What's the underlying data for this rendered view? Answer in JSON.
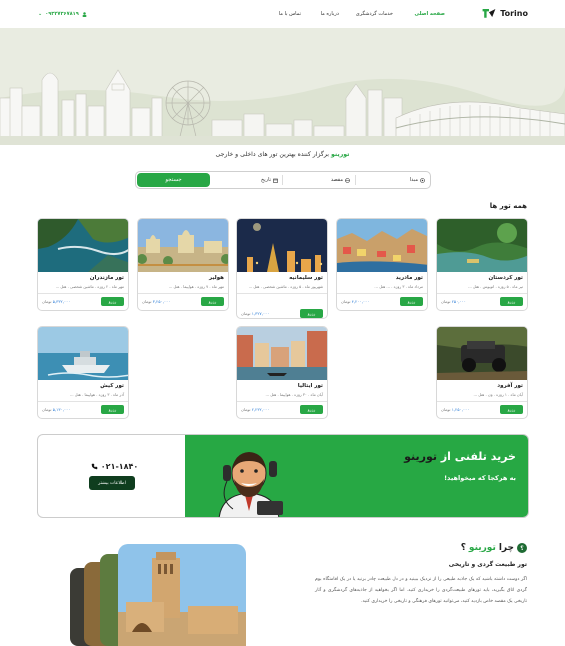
{
  "header": {
    "logo_text": "Torino",
    "nav": [
      "صفحه اصلی",
      "خدمات گردشگری",
      "درباره ما",
      "تماس با ما"
    ],
    "phone": "۰۹۳۲۷۳۶۷۸۱۹"
  },
  "hero": {
    "tagline_brand": "تورینو",
    "tagline_rest": " برگزار کننده بهترین تور های داخلی و خارجی"
  },
  "search": {
    "origin": "مبدا",
    "destination": "مقصد",
    "date": "تاریخ",
    "button": "جستجو"
  },
  "tours_title": "همه تور ها",
  "tours": [
    {
      "title": "تور کردستان",
      "details": "تیر ماه . ۵ روزه . اتوبوس . هتل ...",
      "price": "۲۵۰,۰۰۰",
      "currency": "تومان",
      "button": "رزرو"
    },
    {
      "title": "تور مادرید",
      "details": "مرداد ماه . ۳ روزه . ... هتل ...",
      "price": "۴,۲۰۰,۰۰۰",
      "currency": "تومان",
      "button": "رزرو"
    },
    {
      "title": "تور سلیمانیه",
      "details": "شهریور ماه . ۵ روزه . ماشین شخصی . هتل ...",
      "price": "۱,۳۲۷,۰۰۰",
      "currency": "تومان",
      "button": "رزرو"
    },
    {
      "title": "هولیر",
      "details": "مهر ماه . ۷ روزه . هواپیما . هتل ...",
      "price": "۳,۲۵۰,۰۰۰",
      "currency": "تومان",
      "button": "رزرو"
    },
    {
      "title": "تور مازندران",
      "details": "مهر ماه . ۲ روزه . ماشین شخصی . هتل ...",
      "price": "۵,۳۳۲,۰۰۰",
      "currency": "تومان",
      "button": "رزرو"
    },
    {
      "title": "تور آفرود",
      "details": "آبان ماه . ۱ روزه . ون . هتل ...",
      "price": "۱,۲۵۰,۰۰۰",
      "currency": "تومان",
      "button": "رزرو"
    },
    {
      "title": "تور ایتالیا",
      "details": "آبان ماه . ۳۰ روزه . هواپیما . هتل ...",
      "price": "۲,۲۳۲,۰۰۰",
      "currency": "تومان",
      "button": "رزرو"
    },
    {
      "title": "تور کیش",
      "details": "آذر ماه . ۳ روزه . هواپیما . هتل ...",
      "price": "۵,۱۳۰,۰۰۰",
      "currency": "تومان",
      "button": "رزرو"
    }
  ],
  "banner": {
    "title_part1": "خرید تلفنی از ",
    "title_part2": "تورینو",
    "subtitle": "به هرکجا که میخواهید!",
    "phone": "۰۲۱-۱۸۴۰",
    "info_button": "اطلاعات بیشتر"
  },
  "why": {
    "badge": "؟",
    "title_part1": "چرا ",
    "title_part2": "تورینو",
    "subtitle": "تور طبیعت گردی و تاریخی",
    "body": "اگر دوست داشته باشید که یک جاذبه طبیعی را از نزدیک ببینید و در دل طبیعت چادر بزنید یا در یک اقامتگاه بوم گردی اتاق بگیرید، باید تورهای طبیعت‌گردی را خریداری کنید. اما اگر بخواهید از جاذبه‌های گردشگری و آثار تاریخی یک مقصد خاص بازدید کنید، می‌توانید تورهای فرهنگی و تاریخی را خریداری کنید."
  },
  "colors": {
    "brand_green": "#28a745",
    "dark_green": "#0f3d1e",
    "price_blue": "#2a7bd6"
  }
}
